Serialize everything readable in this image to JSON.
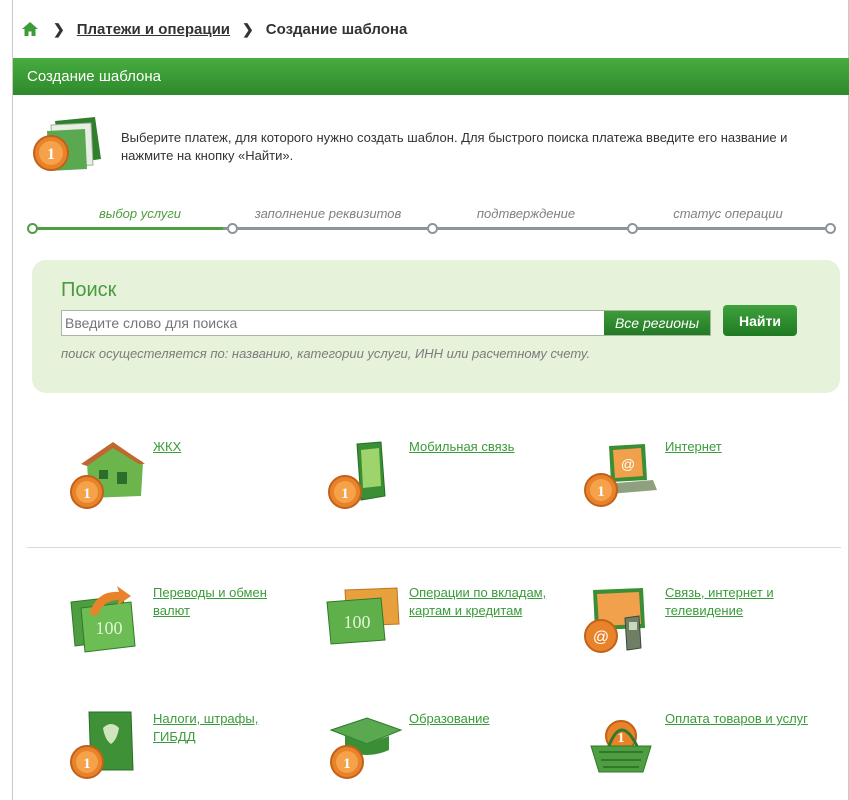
{
  "breadcrumb": {
    "home_icon": "home-icon",
    "parent": "Платежи и операции",
    "current": "Создание шаблона"
  },
  "header": {
    "title": "Создание шаблона"
  },
  "intro": {
    "icon": "folder-coin-icon",
    "text": "Выберите платеж, для которого нужно создать шаблон. Для быстрого поиска платежа введите его название и нажмите на кнопку «Найти»."
  },
  "steps": [
    {
      "label": "выбор услуги",
      "active": true
    },
    {
      "label": "заполнение реквизитов",
      "active": false
    },
    {
      "label": "подтверждение",
      "active": false
    },
    {
      "label": "статус операции",
      "active": false
    }
  ],
  "search": {
    "title": "Поиск",
    "placeholder": "Введите слово для поиска",
    "region_button": "Все регионы",
    "find_button": "Найти",
    "hint": "поиск осущестеляется по: названию, категории услуги, ИНН или расчетному счету."
  },
  "categories": [
    {
      "label": "ЖКХ",
      "icon": "house-icon"
    },
    {
      "label": "Мобильная связь",
      "icon": "mobile-phone-icon"
    },
    {
      "label": "Интернет",
      "icon": "laptop-icon"
    },
    {
      "label": "Переводы и обмен валют",
      "icon": "money-transfer-icon"
    },
    {
      "label": "Операции по вкладам, картам и кредитам",
      "icon": "banknotes-icon"
    },
    {
      "label": "Связь, интернет и телевидение",
      "icon": "telecom-icon"
    },
    {
      "label": "Налоги, штрафы, ГИБДД",
      "icon": "emblem-icon"
    },
    {
      "label": "Образование",
      "icon": "graduation-cap-icon"
    },
    {
      "label": "Оплата товаров и услуг",
      "icon": "shopping-basket-icon"
    }
  ],
  "colors": {
    "brand_green": "#2e8a2c",
    "link_green": "#3a9b3a",
    "search_bg": "#e6f2da",
    "coin_orange": "#e8832a"
  }
}
